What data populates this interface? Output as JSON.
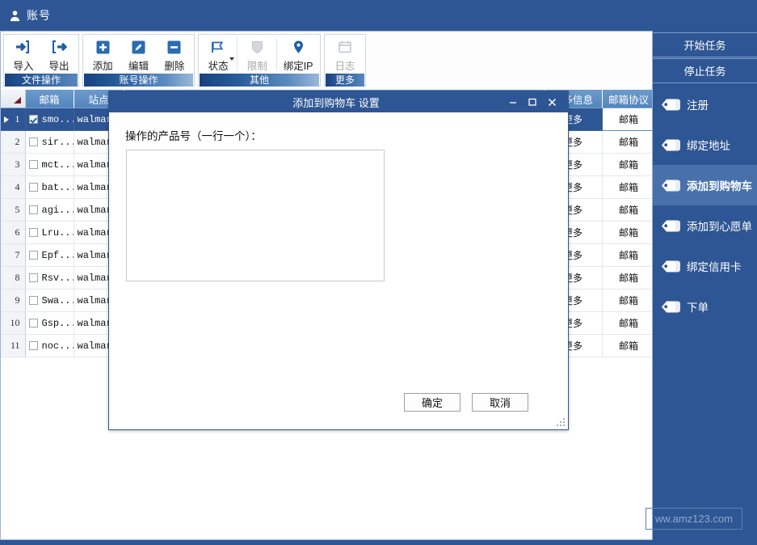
{
  "titlebar": {
    "title": "账号",
    "icon": "user-icon"
  },
  "ribbon": {
    "groups": [
      {
        "caption": "文件操作",
        "buttons": [
          {
            "label": "导入",
            "icon": "import-arrow-icon",
            "disabled": false
          },
          {
            "label": "导出",
            "icon": "export-arrow-icon",
            "disabled": false
          }
        ]
      },
      {
        "caption": "账号操作",
        "buttons": [
          {
            "label": "添加",
            "icon": "plus-square-icon",
            "disabled": false
          },
          {
            "label": "编辑",
            "icon": "pencil-square-icon",
            "disabled": false
          },
          {
            "label": "删除",
            "icon": "minus-square-icon",
            "disabled": false
          }
        ]
      },
      {
        "caption": "其他",
        "buttons": [
          {
            "label": "状态",
            "icon": "flag-icon",
            "disabled": false,
            "dropdown": true
          },
          {
            "label": "限制",
            "icon": "shield-icon",
            "disabled": true
          },
          {
            "label": "绑定IP",
            "icon": "map-pin-icon",
            "disabled": false
          }
        ]
      },
      {
        "caption": "更多",
        "buttons": [
          {
            "label": "日志",
            "icon": "calendar-icon",
            "disabled": true
          }
        ]
      }
    ]
  },
  "grid": {
    "columns": [
      "",
      "邮箱",
      "站点",
      "更多信息",
      "邮箱协议"
    ],
    "rows": [
      {
        "n": "1",
        "checked": true,
        "email": "smo...",
        "site": "walmar..",
        "more": "更多",
        "proto": "邮箱",
        "selected": true
      },
      {
        "n": "2",
        "checked": false,
        "email": "sir...",
        "site": "walmar..",
        "more": "更多",
        "proto": "邮箱",
        "selected": false
      },
      {
        "n": "3",
        "checked": false,
        "email": "mct...",
        "site": "walmar..",
        "more": "更多",
        "proto": "邮箱",
        "selected": false
      },
      {
        "n": "4",
        "checked": false,
        "email": "bat...",
        "site": "walmar..",
        "more": "更多",
        "proto": "邮箱",
        "selected": false
      },
      {
        "n": "5",
        "checked": false,
        "email": "agi...",
        "site": "walmar..",
        "more": "更多",
        "proto": "邮箱",
        "selected": false
      },
      {
        "n": "6",
        "checked": false,
        "email": "Lru...",
        "site": "walmar..",
        "more": "更多",
        "proto": "邮箱",
        "selected": false
      },
      {
        "n": "7",
        "checked": false,
        "email": "Epf...",
        "site": "walmar..",
        "more": "更多",
        "proto": "邮箱",
        "selected": false
      },
      {
        "n": "8",
        "checked": false,
        "email": "Rsv...",
        "site": "walmar..",
        "more": "更多",
        "proto": "邮箱",
        "selected": false
      },
      {
        "n": "9",
        "checked": false,
        "email": "Swa...",
        "site": "walmar..",
        "more": "更多",
        "proto": "邮箱",
        "selected": false
      },
      {
        "n": "10",
        "checked": false,
        "email": "Gsp...",
        "site": "walmar..",
        "more": "更多",
        "proto": "邮箱",
        "selected": false
      },
      {
        "n": "11",
        "checked": false,
        "email": "noc...",
        "site": "walmar..",
        "more": "更多",
        "proto": "邮箱",
        "selected": false
      }
    ]
  },
  "side_panel": {
    "task_buttons": [
      {
        "label": "开始任务"
      },
      {
        "label": "停止任务"
      }
    ],
    "items": [
      {
        "label": "注册",
        "icon": "tag-icon",
        "active": false
      },
      {
        "label": "绑定地址",
        "icon": "tag-icon",
        "active": false
      },
      {
        "label": "添加到购物车",
        "icon": "tag-icon",
        "active": true
      },
      {
        "label": "添加到心愿单",
        "icon": "tag-icon",
        "active": false
      },
      {
        "label": "绑定信用卡",
        "icon": "tag-icon",
        "active": false
      },
      {
        "label": "下单",
        "icon": "tag-icon",
        "active": false
      }
    ]
  },
  "watermark": {
    "text": "ww.amz123.com"
  },
  "dialog": {
    "title": "添加到购物车 设置",
    "label": "操作的产品号（一行一个）：",
    "textarea_value": "",
    "textarea_placeholder": "",
    "ok_label": "确定",
    "cancel_label": "取消",
    "controls": {
      "minimize": "minimize-icon",
      "maximize": "maximize-icon",
      "close": "close-icon"
    }
  },
  "colors": {
    "brand_blue": "#2e5694",
    "header_blue": "#5b8ec4",
    "active_side": "#4871ab",
    "ribbon_caption_dark": "#17427e"
  }
}
